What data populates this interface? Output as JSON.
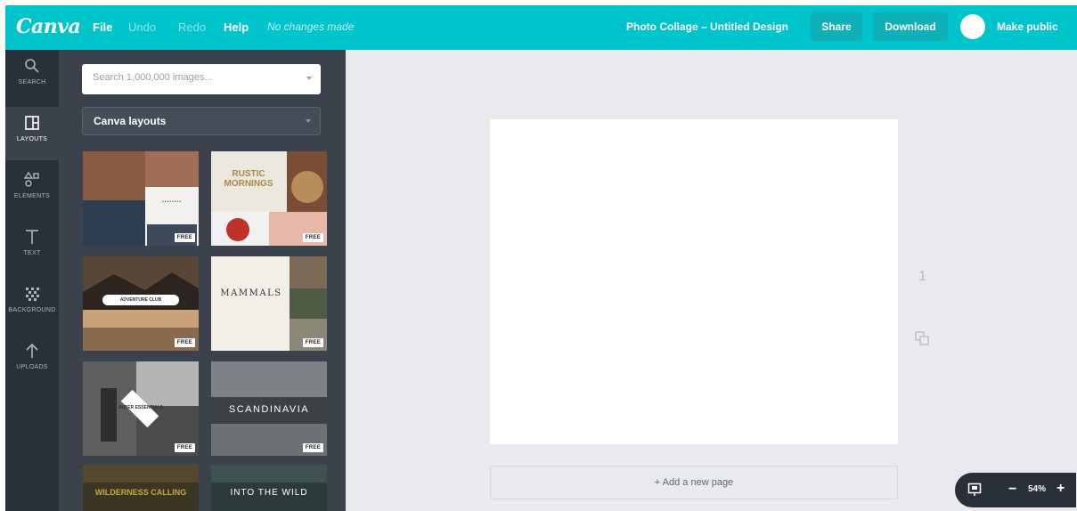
{
  "topbar": {
    "logo": "Canva",
    "menu": {
      "file": "File",
      "undo": "Undo",
      "redo": "Redo",
      "help": "Help"
    },
    "status": "No changes made",
    "document_title": "Photo Collage – Untitled Design",
    "share_label": "Share",
    "download_label": "Download",
    "make_public_label": "Make public"
  },
  "rail": {
    "items": [
      {
        "label": "SEARCH",
        "icon": "search-icon"
      },
      {
        "label": "LAYOUTS",
        "icon": "layouts-icon",
        "active": true
      },
      {
        "label": "ELEMENTS",
        "icon": "elements-icon"
      },
      {
        "label": "TEXT",
        "icon": "text-icon"
      },
      {
        "label": "BACKGROUND",
        "icon": "background-icon"
      },
      {
        "label": "UPLOADS",
        "icon": "upload-icon"
      }
    ]
  },
  "panel": {
    "search_placeholder": "Search 1,000,000 images...",
    "layout_select_value": "Canva layouts",
    "free_badge": "FREE",
    "layouts": [
      {
        "text": "••••••••"
      },
      {
        "text": "RUSTIC MORNINGS"
      },
      {
        "text": "ADVENTURE CLUB"
      },
      {
        "text": "MAMMALS"
      },
      {
        "text": "SUPER ESSENTIALS"
      },
      {
        "text": "SCANDINAVIA"
      },
      {
        "text": "WILDERNESS CALLING"
      },
      {
        "text": "INTO THE WILD"
      }
    ]
  },
  "canvas": {
    "page_number": "1",
    "add_page_label": "+ Add a new page"
  },
  "zoom": {
    "minus": "−",
    "level": "54%",
    "plus": "+"
  },
  "colors": {
    "topbar": "#00c4cc",
    "rail": "#293039",
    "panel": "#3b424c",
    "workspace": "#e8eaed"
  }
}
